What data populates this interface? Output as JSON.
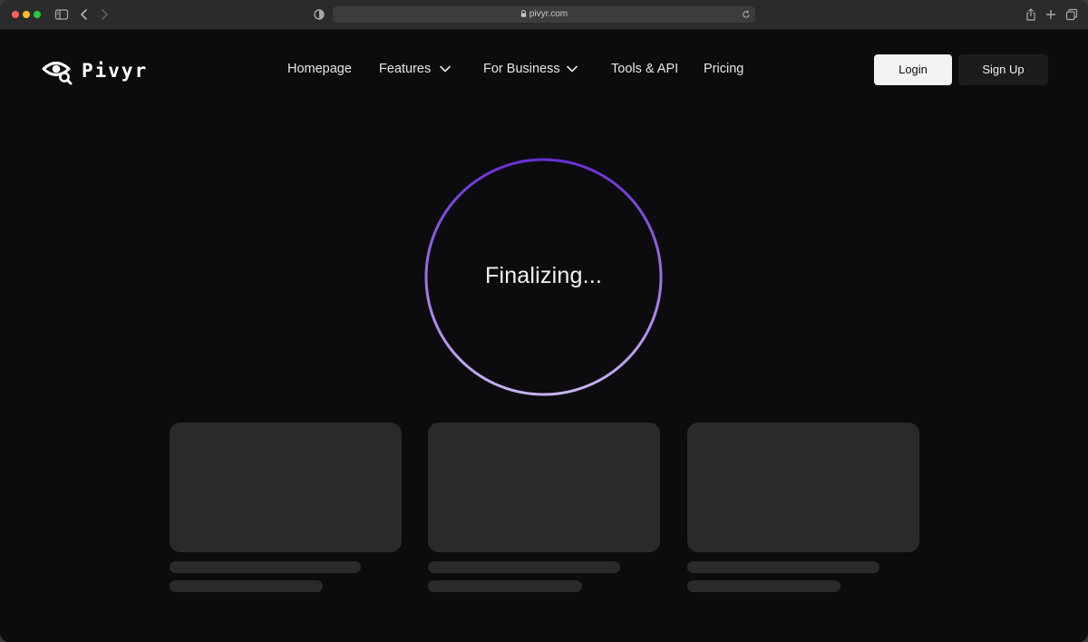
{
  "browser": {
    "url": "pivyr.com"
  },
  "site": {
    "brand": "Pivyr",
    "nav": {
      "homepage": "Homepage",
      "features": "Features",
      "for_business": "For Business",
      "tools_api": "Tools & API",
      "pricing": "Pricing"
    },
    "login_label": "Login",
    "signup_label": "Sign Up"
  },
  "loader": {
    "status_text": "Finalizing...",
    "gradient_colors": [
      "#6a2fd6",
      "#c9b2f3"
    ]
  },
  "skeleton_cards": 3,
  "icons": [
    "sidebar-icon",
    "back-chevron-icon",
    "forward-chevron-icon",
    "shield-icon",
    "lock-icon",
    "reload-icon",
    "share-icon",
    "new-tab-icon",
    "tabs-overview-icon",
    "eye-search-logo-icon",
    "chevron-down-icon"
  ]
}
